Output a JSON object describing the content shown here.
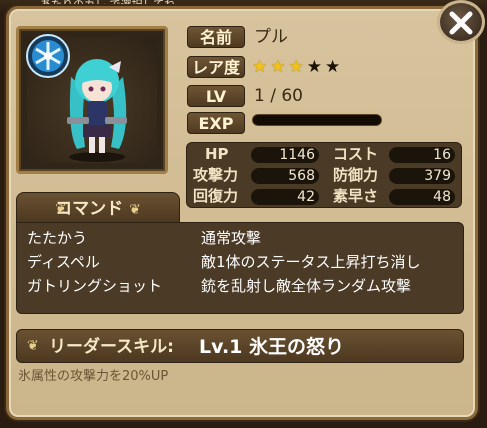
{
  "header": {
    "strip_text": "あたりのカレ で選択してね"
  },
  "character": {
    "name_label": "名前",
    "name": "プル",
    "rarity_label": "レア度",
    "rarity": {
      "filled": 3,
      "total": 5
    },
    "level_label": "LV",
    "level": "1 / 60",
    "exp_label": "EXP",
    "exp_progress": 0
  },
  "stats": {
    "hp_label": "HP",
    "hp": "1146",
    "cost_label": "コスト",
    "cost": "16",
    "atk_label": "攻撃力",
    "atk": "568",
    "def_label": "防御力",
    "def": "379",
    "rec_label": "回復力",
    "rec": "42",
    "spd_label": "素早さ",
    "spd": "48"
  },
  "command": {
    "tab_label": "コマンド",
    "rows": [
      {
        "name": "たたかう",
        "desc": "通常攻撃"
      },
      {
        "name": "ディスペル",
        "desc": "敵1体のステータス上昇打ち消し"
      },
      {
        "name": "ガトリングショット",
        "desc": "銃を乱射し敵全体ランダム攻撃"
      }
    ]
  },
  "leader_skill": {
    "label": "リーダースキル:",
    "name": "Lv.1 氷王の怒り",
    "description": "氷属性の攻撃力を20%UP"
  },
  "colors": {
    "panel": "#cfb98f",
    "dark_box": "#4a3a26",
    "star": "#f2c21a"
  },
  "icons": {
    "close": "close-x-icon",
    "emblem": "ice-crystal-emblem-icon"
  }
}
